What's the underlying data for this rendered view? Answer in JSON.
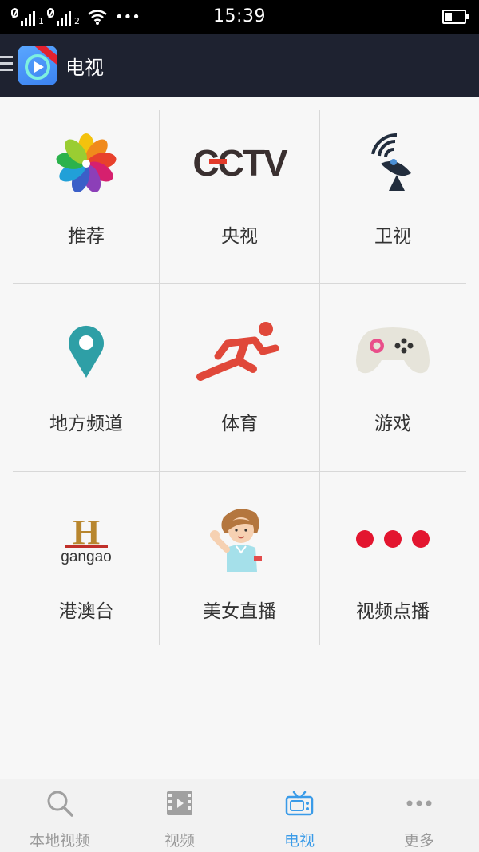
{
  "status_bar": {
    "time": "15:39",
    "icons": [
      "signal-1-icon",
      "signal-2-icon",
      "wifi-icon",
      "more-dots-icon",
      "battery-icon"
    ]
  },
  "header": {
    "title": "电视",
    "icons": [
      "menu-icon",
      "app-logo"
    ]
  },
  "categories": [
    {
      "label": "推荐",
      "icon": "flower-petals-icon"
    },
    {
      "label": "央视",
      "icon": "cctv-logo-icon"
    },
    {
      "label": "卫视",
      "icon": "satellite-dish-icon"
    },
    {
      "label": "地方频道",
      "icon": "location-pin-icon"
    },
    {
      "label": "体育",
      "icon": "runner-icon"
    },
    {
      "label": "游戏",
      "icon": "gamepad-icon"
    },
    {
      "label": "港澳台",
      "icon": "gangao-logo-icon"
    },
    {
      "label": "美女直播",
      "icon": "girl-waving-icon"
    },
    {
      "label": "视频点播",
      "icon": "three-dots-icon"
    }
  ],
  "logos": {
    "cctv": "CCTV",
    "gangao_h": "H",
    "gangao_text": "gangao"
  },
  "bottom_nav": {
    "items": [
      {
        "label": "本地视频",
        "icon": "search-icon"
      },
      {
        "label": "视频",
        "icon": "film-icon"
      },
      {
        "label": "电视",
        "icon": "tv-icon"
      },
      {
        "label": "更多",
        "icon": "more-dots-icon"
      }
    ],
    "active_index": 2
  },
  "colors": {
    "header_bg": "#1e2230",
    "accent": "#3a9be8",
    "dots_red": "#e3152f"
  }
}
